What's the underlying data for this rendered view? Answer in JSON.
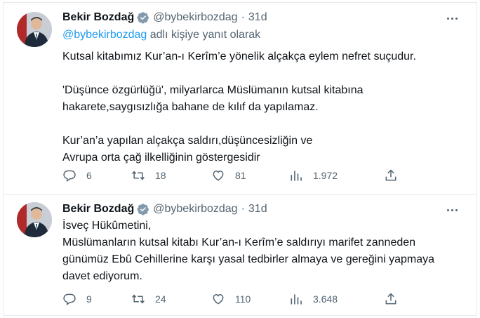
{
  "tweets": [
    {
      "author_name": "Bekir Bozdağ",
      "handle": "@bybekirbozdag",
      "separator": "·",
      "time": "31d",
      "reply_to_mention": "@bybekirbozdag",
      "reply_to_suffix": " adlı kişiye yanıt olarak",
      "paragraphs": [
        [
          "Kutsal kitabımız Kur’an-ı Kerîm’e yönelik alçakça eylem nefret suçudur."
        ],
        [
          "'Düşünce özgürlüğü', milyarlarca Müslümanın kutsal kitabına",
          "hakarete,saygısızlığa bahane de kılıf da yapılamaz."
        ],
        [
          "Kur’an’a yapılan alçakça saldırı,düşüncesizliğin ve",
          "Avrupa orta çağ ilkelliğinin göstergesidir"
        ]
      ],
      "counts": {
        "replies": "6",
        "retweets": "18",
        "likes": "81",
        "views": "1.972"
      }
    },
    {
      "author_name": "Bekir Bozdağ",
      "handle": "@bybekirbozdag",
      "separator": "·",
      "time": "31d",
      "paragraphs": [
        [
          "İsveç Hükûmetini,",
          "Müslümanların kutsal kitabı Kur’an-ı Kerîm’e saldırıyı marifet zanneden",
          "günümüz Ebû Cehillerine karşı yasal tedbirler almaya ve gereğini yapmaya",
          "davet ediyorum."
        ]
      ],
      "counts": {
        "replies": "9",
        "retweets": "24",
        "likes": "110",
        "views": "3.648"
      }
    }
  ],
  "icons": {
    "verified": "verified-badge-icon",
    "more": "more-options-icon",
    "reply": "reply-icon",
    "retweet": "retweet-icon",
    "like": "like-icon",
    "views": "views-icon",
    "share": "share-icon"
  },
  "colors": {
    "link": "#1d9bf0",
    "secondary_text": "#536471",
    "primary_text": "#0f1419",
    "divider": "#e6e9eb"
  }
}
